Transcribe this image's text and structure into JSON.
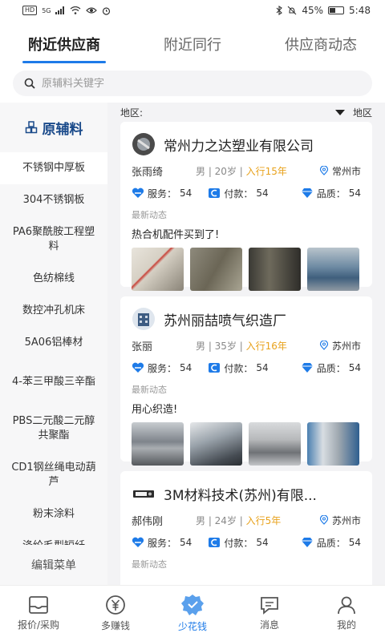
{
  "status_bar": {
    "hd": "HD",
    "net": "5G",
    "battery_text": "45%",
    "battery_level": 0.45,
    "time": "5:48"
  },
  "top_tabs": [
    {
      "label": "附近供应商",
      "active": true
    },
    {
      "label": "附近同行",
      "active": false
    },
    {
      "label": "供应商动态",
      "active": false
    }
  ],
  "search": {
    "placeholder": "原辅料关键字",
    "value": ""
  },
  "sidebar": {
    "header": "原辅料",
    "items": [
      {
        "label": "不锈钢中厚板",
        "active": true
      },
      {
        "label": "304不锈钢板"
      },
      {
        "label": "PA6聚酰胺工程塑料"
      },
      {
        "label": "色纺棉线"
      },
      {
        "label": "数控冲孔机床"
      },
      {
        "label": "5A06铝棒材"
      },
      {
        "label": "4-苯三甲酸三辛酯"
      },
      {
        "label": "PBS二元酸二元醇共聚酯"
      },
      {
        "label": "CD1钢丝绳电动葫芦"
      },
      {
        "label": "粉末涂料"
      },
      {
        "label": "涤纶毛型短纤"
      }
    ],
    "edit_label": "编辑菜单"
  },
  "region": {
    "left_label": "地区:",
    "right_label": "地区"
  },
  "cards": [
    {
      "company": "常州力之达塑业有限公司",
      "person": "张雨绮",
      "gender_age": "男 | 20岁 | ",
      "years": "入行15年",
      "city": "常州市",
      "service_label": "服务：",
      "service": "54",
      "payment_label": "付款：",
      "payment": "54",
      "quality_label": "品质：",
      "quality": "54",
      "dyn_label": "最新动态",
      "dyn_text": "热合机配件买到了!"
    },
    {
      "company": "苏州丽喆喷气织造厂",
      "person": "张丽",
      "gender_age": "男 | 35岁 | ",
      "years": "入行16年",
      "city": "苏州市",
      "service_label": "服务：",
      "service": "54",
      "payment_label": "付款：",
      "payment": "54",
      "quality_label": "品质：",
      "quality": "54",
      "dyn_label": "最新动态",
      "dyn_text": "用心织造!"
    },
    {
      "company": "3M材料技术(苏州)有限...",
      "person": "郝伟刚",
      "gender_age": "男 | 24岁 | ",
      "years": "入行5年",
      "city": "苏州市",
      "service_label": "服务：",
      "service": "54",
      "payment_label": "付款：",
      "payment": "54",
      "quality_label": "品质：",
      "quality": "54",
      "dyn_label": "最新动态"
    }
  ],
  "bottom_nav": [
    {
      "label": "报价/采购",
      "icon": "inbox-icon"
    },
    {
      "label": "多赚钱",
      "icon": "yen-coin-icon"
    },
    {
      "label": "少花钱",
      "icon": "badge-icon",
      "active": true
    },
    {
      "label": "消息",
      "icon": "chat-icon"
    },
    {
      "label": "我的",
      "icon": "person-icon"
    }
  ],
  "colors": {
    "accent": "#1e7be8",
    "years": "#e8a21c",
    "sidebar_header": "#1a4a8a"
  }
}
